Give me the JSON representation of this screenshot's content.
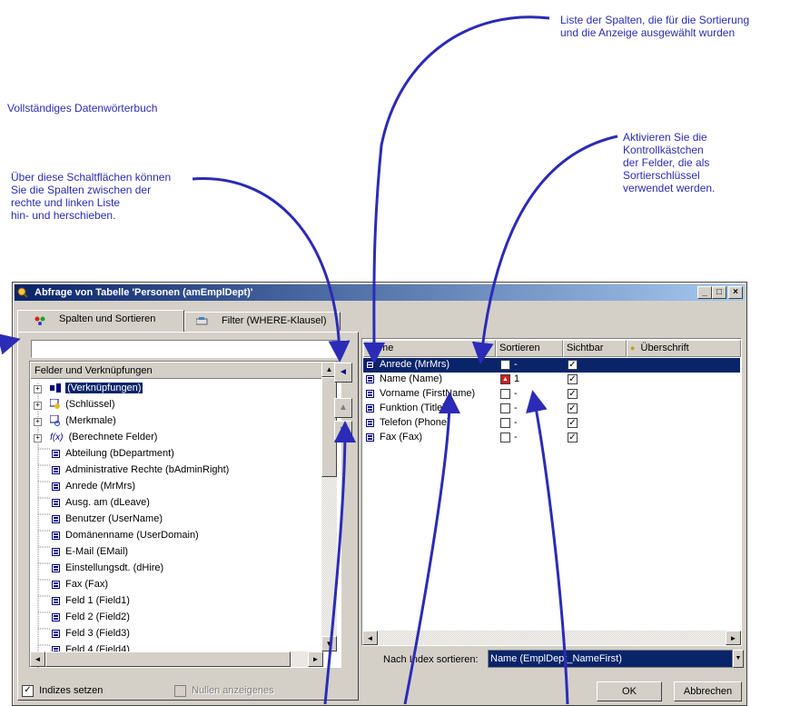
{
  "annotations": {
    "columns_list": [
      "Liste der Spalten, die für die Sortierung",
      "und die Anzeige ausgewählt wurden"
    ],
    "data_dictionary": "Vollständiges Datenwörterbuch",
    "move_buttons": [
      "Über diese Schaltflächen können",
      "Sie die Spalten zwischen der",
      "rechte und linken Liste",
      "hin- und herschieben."
    ],
    "checkboxes": [
      "Aktivieren Sie die",
      "Kontrollkästchen",
      "der Felder, die als",
      "Sortierschlüssel",
      "verwendet werden."
    ]
  },
  "window": {
    "title": "Abfrage von Tabelle 'Personen (amEmplDept)'",
    "minimize": "_",
    "maximize": "□",
    "close": "×"
  },
  "tabs": [
    {
      "label": "Spalten und Sortieren",
      "icon": "columns-icon"
    },
    {
      "label": "Filter (WHERE-Klausel)",
      "icon": "filter-icon"
    }
  ],
  "left_list": {
    "search_value": "",
    "header": "Felder und Verknüpfungen",
    "tree_items": [
      {
        "label": "(Verknüpfungen)",
        "selected": true
      },
      {
        "label": "(Schlüssel)"
      },
      {
        "label": "(Merkmale)"
      },
      {
        "label": "(Berechnete Felder)"
      }
    ],
    "fields": [
      "Abteilung (bDepartment)",
      "Administrative Rechte (bAdminRight)",
      "Anrede (MrMrs)",
      "Ausg. am (dLeave)",
      "Benutzer (UserName)",
      "Domänenname (UserDomain)",
      "E-Mail (EMail)",
      "Einstellungsdt. (dHire)",
      "Fax (Fax)",
      "Feld 1 (Field1)",
      "Feld 2 (Field2)",
      "Feld 3 (Field3)",
      "Feld 4 (Field4)"
    ]
  },
  "move_buttons": {
    "left": "◄",
    "up": "▲",
    "down": "▼"
  },
  "grid": {
    "headers": [
      "Name",
      "Sortieren",
      "Sichtbar",
      "Überschrift"
    ],
    "rows": [
      {
        "name": "Anrede (MrMrs)",
        "sort_checked": false,
        "sort_value": "-",
        "visible": true,
        "selected": true
      },
      {
        "name": "Name (Name)",
        "sort_checked": true,
        "sort_value": "1",
        "visible": true
      },
      {
        "name": "Vorname (FirstName)",
        "sort_checked": false,
        "sort_value": "-",
        "visible": true
      },
      {
        "name": "Funktion (Title)",
        "sort_checked": false,
        "sort_value": "-",
        "visible": true
      },
      {
        "name": "Telefon (Phone)",
        "sort_checked": false,
        "sort_value": "-",
        "visible": true
      },
      {
        "name": "Fax (Fax)",
        "sort_checked": false,
        "sort_value": "-",
        "visible": true
      }
    ]
  },
  "sort_index": {
    "label": "Nach Index sortieren:",
    "value": "Name (EmplDept_NameFirst)"
  },
  "footer": {
    "set_indexes": "Indizes setzen",
    "show_nulls": "Nullen anzeigenes",
    "ok": "OK",
    "cancel": "Abbrechen"
  },
  "colors": {
    "annotation": "#2b2bb8",
    "title_bar": "#0a246a",
    "selection": "#0a246a"
  }
}
